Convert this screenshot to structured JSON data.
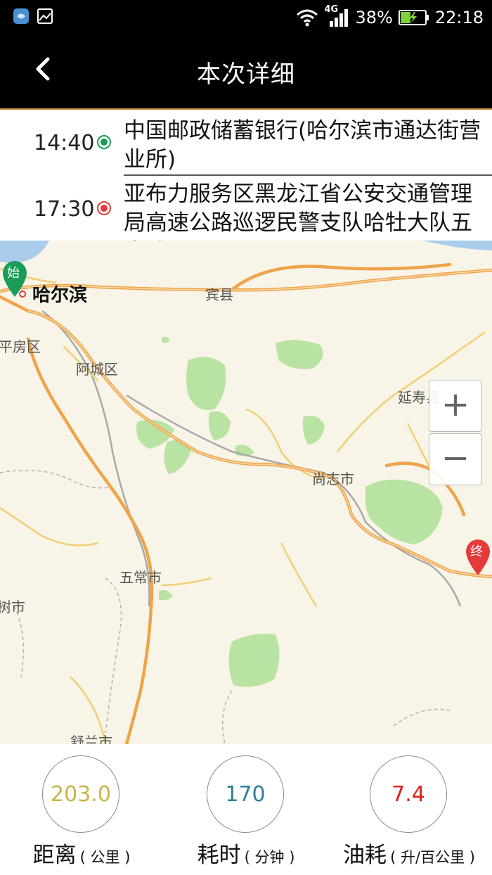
{
  "status_bar": {
    "network": "4G",
    "battery": "38%",
    "time": "22:18"
  },
  "header": {
    "title": "本次详细"
  },
  "route": [
    {
      "time": "14:40",
      "name": "中国邮政储蓄银行(哈尔滨市通达街营业所)",
      "status_color": "#1a9b5a"
    },
    {
      "time": "17:30",
      "name": "亚布力服务区黑龙江省公安交通管理局高速公路巡逻民警支队哈牡大队五中队",
      "status_color": "#e53a3a"
    }
  ],
  "map": {
    "start_marker": "始",
    "end_marker": "终",
    "places": [
      "哈尔滨",
      "宾县",
      "平房区",
      "阿城区",
      "延寿县",
      "尚志市",
      "五常市",
      "树市",
      "舒兰市"
    ],
    "zoom_in": "+",
    "zoom_out": "−"
  },
  "stats": {
    "distance": {
      "value": "203.0",
      "label": "距离",
      "unit": "( 公里 )",
      "color": "#c9b44a"
    },
    "duration": {
      "value": "170",
      "label": "耗时",
      "unit": "( 分钟 )",
      "color": "#2e7e9c"
    },
    "fuel": {
      "value": "7.4",
      "label": "油耗",
      "unit": "( 升/百公里 )",
      "color": "#e01e1e"
    }
  }
}
